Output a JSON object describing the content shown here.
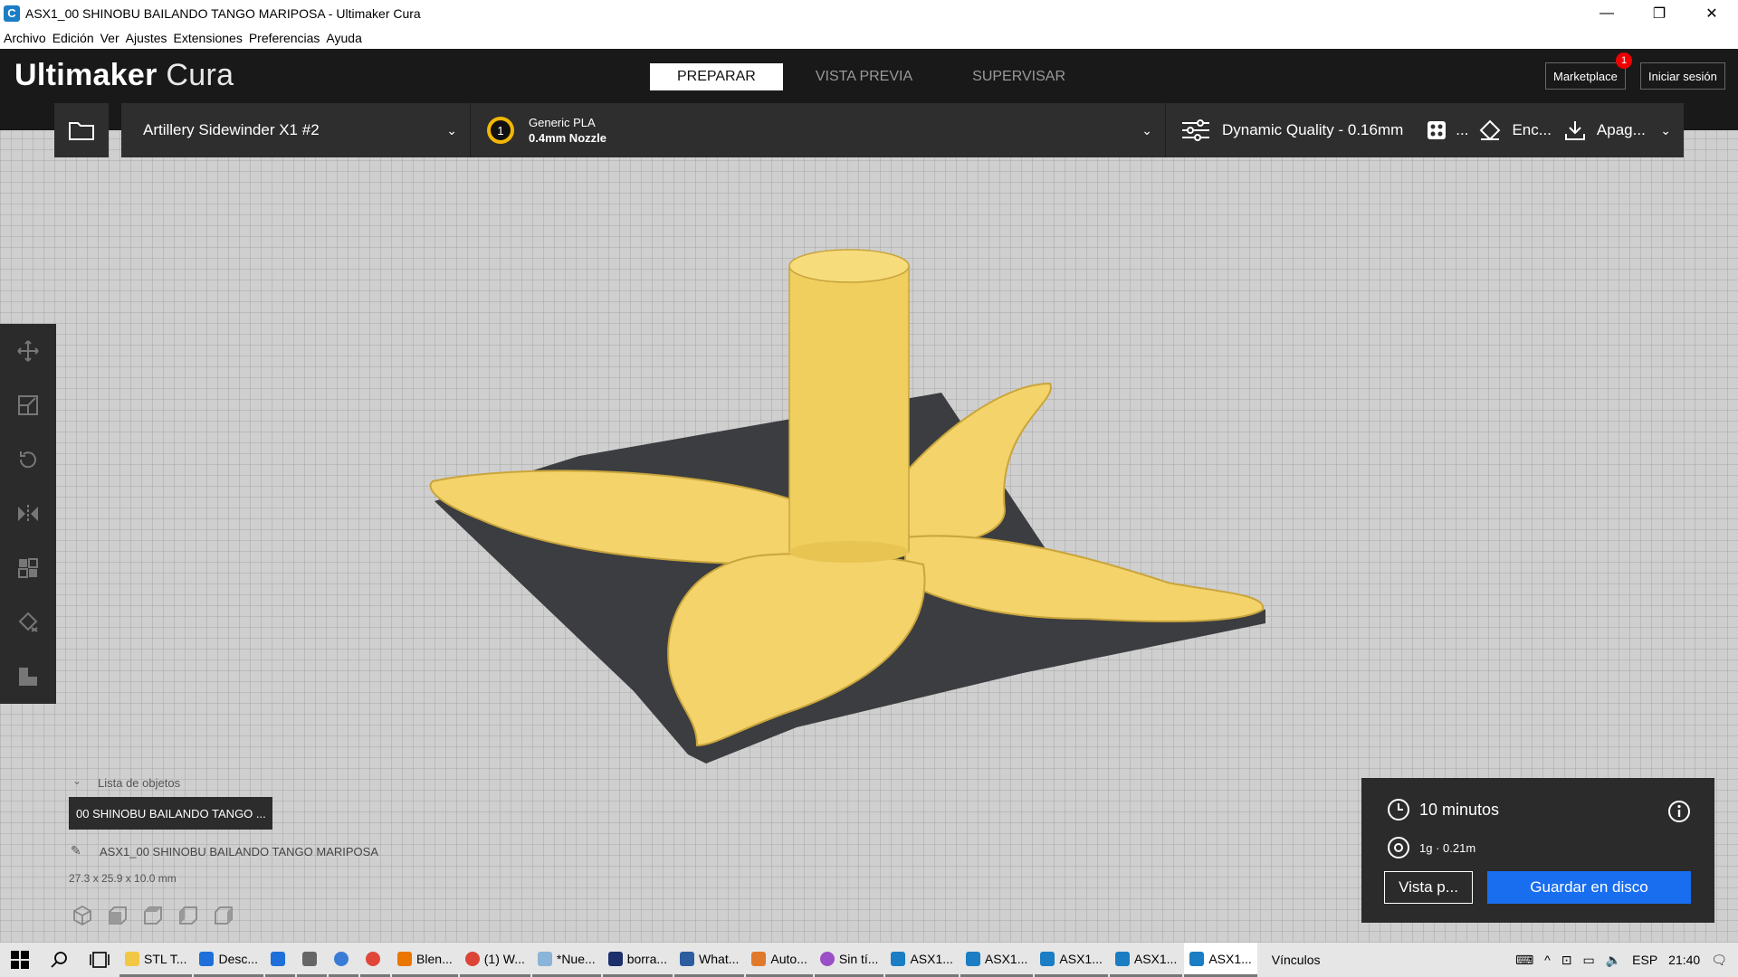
{
  "window": {
    "title": "ASX1_00 SHINOBU BAILANDO TANGO MARIPOSA - Ultimaker Cura",
    "app_icon": "C",
    "controls": {
      "minimize": "—",
      "maximize": "❐",
      "close": "✕"
    }
  },
  "menu": [
    "Archivo",
    "Edición",
    "Ver",
    "Ajustes",
    "Extensiones",
    "Preferencias",
    "Ayuda"
  ],
  "header": {
    "logo_bold": "Ultimaker",
    "logo_rest": " Cura",
    "stages": [
      "PREPARAR",
      "VISTA PREVIA",
      "SUPERVISAR"
    ],
    "marketplace": "Marketplace",
    "marketplace_badge": "1",
    "signin": "Iniciar sesión"
  },
  "toolbar": {
    "printer": "Artillery Sidewinder X1 #2",
    "material_badge": "1",
    "material": "Generic PLA",
    "nozzle": "0.4mm Nozzle",
    "profile": "Dynamic Quality - 0.16mm",
    "support_short": "...",
    "adhesion_short": "Enc...",
    "extra_short": "Apag..."
  },
  "objects": {
    "list_label": "Lista de objetos",
    "item": "00 SHINOBU BAILANDO TANGO ...",
    "name": "ASX1_00 SHINOBU BAILANDO TANGO MARIPOSA",
    "dims": "27.3 x 25.9 x 10.0 mm"
  },
  "print_info": {
    "time": "10 minutos",
    "material_usage": "1g · 0.21m",
    "preview_button": "Vista p...",
    "save_button": "Guardar en disco"
  },
  "taskbar": {
    "apps": [
      {
        "label": "STL T...",
        "color": "#f2c744"
      },
      {
        "label": "Desc...",
        "color": "#1e6fd9"
      },
      {
        "label": "",
        "color": "#1e6fd9"
      },
      {
        "label": "",
        "color": "#666666"
      },
      {
        "label": "",
        "color": "#3a7bd5"
      },
      {
        "label": "",
        "color": "#e0463a"
      },
      {
        "label": "Blen...",
        "color": "#ea7600"
      },
      {
        "label": "(1) W...",
        "color": "#db4437"
      },
      {
        "label": "*Nue...",
        "color": "#8ab4d8"
      },
      {
        "label": "borra...",
        "color": "#1c2f6b"
      },
      {
        "label": "What...",
        "color": "#2c5d9e"
      },
      {
        "label": "Auto...",
        "color": "#e07a2a"
      },
      {
        "label": "Sin tí...",
        "color": "#9a4fc7"
      },
      {
        "label": "ASX1...",
        "color": "#1b7dc3"
      },
      {
        "label": "ASX1...",
        "color": "#1b7dc3"
      },
      {
        "label": "ASX1...",
        "color": "#1b7dc3"
      },
      {
        "label": "ASX1...",
        "color": "#1b7dc3"
      },
      {
        "label": "ASX1...",
        "color": "#1b7dc3"
      }
    ],
    "links": "Vínculos",
    "lang": "ESP",
    "time": "21:40"
  },
  "colors": {
    "model": "#f3d36a",
    "model_dark": "#c9a53c",
    "shadow": "#3b3d40",
    "accent_blue": "#196ef0",
    "header_bg": "#191919"
  }
}
